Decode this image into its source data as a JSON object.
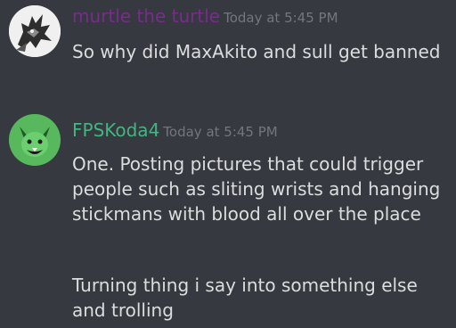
{
  "colors": {
    "background": "#36393f",
    "message_text": "#dcddde",
    "timestamp_text": "#72767d",
    "user1_name": "#7b2a8e",
    "user2_name": "#43b581"
  },
  "messages": [
    {
      "username": "murtle the turtle",
      "timestamp": "Today at 5:45 PM",
      "avatar_icon": "dragon-avatar-icon",
      "lines": [
        "So why did MaxAkito and sull get banned"
      ]
    },
    {
      "username": "FPSKoda4",
      "timestamp": "Today at 5:45 PM",
      "avatar_icon": "green-fox-avatar-icon",
      "lines": [
        "One. Posting pictures that could trigger people such as sliting wrists and hanging stickmans with blood all over the place",
        "Turning thing i say into something else and trolling"
      ]
    }
  ]
}
